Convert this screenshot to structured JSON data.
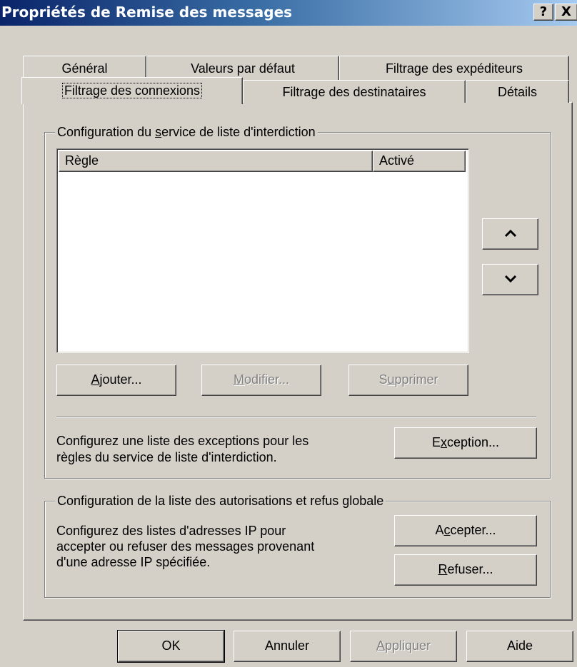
{
  "window": {
    "title": "Propriétés de Remise des messages",
    "help_button": "?",
    "close_button": "X"
  },
  "tabs": {
    "row1": [
      "Général",
      "Valeurs par défaut",
      "Filtrage des expéditeurs"
    ],
    "row2": [
      "Filtrage des connexions",
      "Filtrage des destinataires",
      "Détails"
    ],
    "active": "Filtrage des connexions"
  },
  "blocklist": {
    "group_title_pre": "Configuration du ",
    "group_title_accel": "s",
    "group_title_post": "ervice de liste d'interdiction",
    "columns": [
      "Règle",
      "Activé"
    ],
    "rows": [],
    "move_up_icon": "chevron-up-icon",
    "move_down_icon": "chevron-down-icon",
    "add_button": {
      "accel": "A",
      "rest": "jouter..."
    },
    "modify_button": {
      "accel": "M",
      "rest": "odifier..."
    },
    "delete_button": {
      "pre": "S",
      "accel": "u",
      "rest": "pprimer"
    },
    "exceptions_text_line1": "Configurez une liste des exceptions pour les",
    "exceptions_text_line2": "règles du service de liste d'interdiction.",
    "exception_button": {
      "pre": "E",
      "accel": "x",
      "rest": "ception..."
    }
  },
  "global_list": {
    "group_title": "Configuration de la liste des autorisations et refus globale",
    "text_line1": "Configurez des listes d'adresses IP pour",
    "text_line2": "accepter ou refuser des messages provenant",
    "text_line3": "d'une adresse IP spécifiée.",
    "accept_button": {
      "pre": "A",
      "accel": "c",
      "rest": "cepter..."
    },
    "refuse_button": {
      "accel": "R",
      "rest": "efuser..."
    }
  },
  "footer": {
    "ok": "OK",
    "cancel": "Annuler",
    "apply": {
      "accel": "A",
      "rest": "ppliquer"
    },
    "help": "Aide"
  }
}
